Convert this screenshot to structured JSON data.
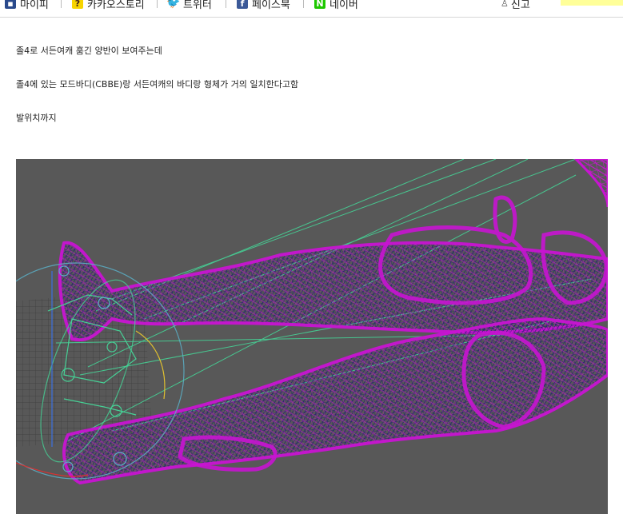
{
  "share_bar": {
    "items": [
      {
        "label": "마이피",
        "icon": "mypi-icon"
      },
      {
        "label": "카카오스토리",
        "icon": "kakaostory-icon"
      },
      {
        "label": "트위터",
        "icon": "twitter-icon"
      },
      {
        "label": "페이스북",
        "icon": "facebook-icon"
      },
      {
        "label": "네이버",
        "icon": "naver-icon"
      }
    ],
    "report_label": "신고"
  },
  "post": {
    "paragraphs": [
      "졸4로 서든여캐 훔긴 양반이 보여주는데",
      "졸4에 있는 모드바디(CBBE)랑 서든여캐의 바디랑 형체가 거의 일치한다고함",
      "발위치까지"
    ],
    "image_icon": "3d-wireframe-legs-viewport"
  },
  "colors": {
    "viewport_bg": "#585858",
    "wire_magenta": "#c814d2",
    "wire_navy": "#1a1f6e",
    "bone_green": "#46d296",
    "accent_yellow": "#ffff99"
  }
}
